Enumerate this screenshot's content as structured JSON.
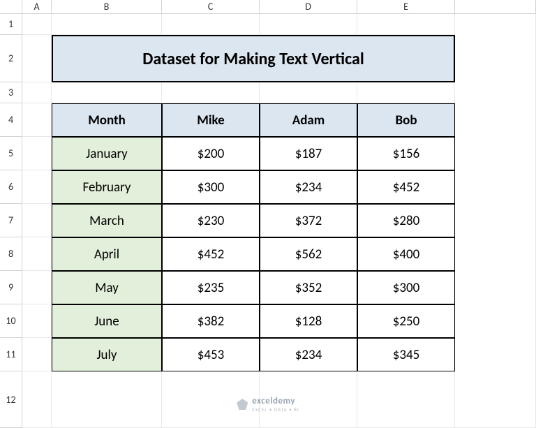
{
  "columns": [
    "A",
    "B",
    "C",
    "D",
    "E"
  ],
  "rows": [
    "1",
    "2",
    "3",
    "4",
    "5",
    "6",
    "7",
    "8",
    "9",
    "10",
    "11",
    "12"
  ],
  "title": "Dataset for Making Text Vertical",
  "headers": {
    "month": "Month",
    "c": "Mike",
    "d": "Adam",
    "e": "Bob"
  },
  "data": [
    {
      "month": "January",
      "c": "$200",
      "d": "$187",
      "e": "$156"
    },
    {
      "month": "February",
      "c": "$300",
      "d": "$234",
      "e": "$452"
    },
    {
      "month": "March",
      "c": "$230",
      "d": "$372",
      "e": "$280"
    },
    {
      "month": "April",
      "c": "$452",
      "d": "$562",
      "e": "$400"
    },
    {
      "month": "May",
      "c": "$235",
      "d": "$352",
      "e": "$300"
    },
    {
      "month": "June",
      "c": "$382",
      "d": "$128",
      "e": "$250"
    },
    {
      "month": "July",
      "c": "$453",
      "d": "$234",
      "e": "$345"
    }
  ],
  "watermark": {
    "brand": "exceldemy",
    "tagline": "EXCEL • DATA • BI"
  }
}
